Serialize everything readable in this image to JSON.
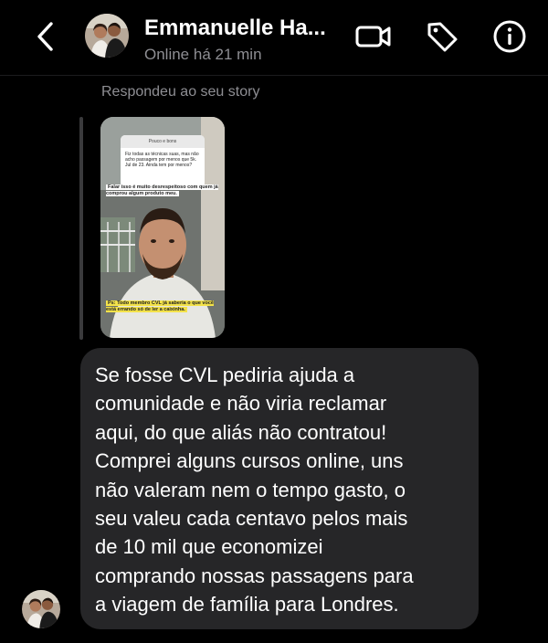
{
  "header": {
    "name": "Emmanuelle Ha...",
    "status": "Online há 21 min",
    "icons": {
      "back": "chevron-left-icon",
      "video": "video-camera-icon",
      "tag": "tag-icon",
      "info": "info-icon"
    }
  },
  "story_reply": {
    "caption": "Respondeu ao seu story",
    "question_header": "Pouco e bons",
    "question_text": "Fiz todas as técnicas suas, mas não acho passagem por menos que 5k. Jul de 23. Ainda tem por menos?",
    "overlay_caption_1": "Falar isso é muito desrespeitoso com quem já comprou algum produto meu.",
    "overlay_caption_2": "Ps: Todo membro CVL já saberia o que você está errando só de ler a caixinha."
  },
  "message": {
    "text": "Se fosse CVL pediria ajuda a\ncomunidade e não viria reclamar\naqui, do que aliás não contratou!\nComprei alguns cursos online, uns\nnão valeram nem o tempo gasto, o\nseu valeu cada centavo pelos mais\nde 10 mil que economizei\ncomprando nossas passagens para\na viagem de família para Londres."
  },
  "colors": {
    "background": "#000000",
    "bubble": "#262628",
    "secondary_text": "#8e8e93",
    "primary_text": "#ffffff"
  }
}
